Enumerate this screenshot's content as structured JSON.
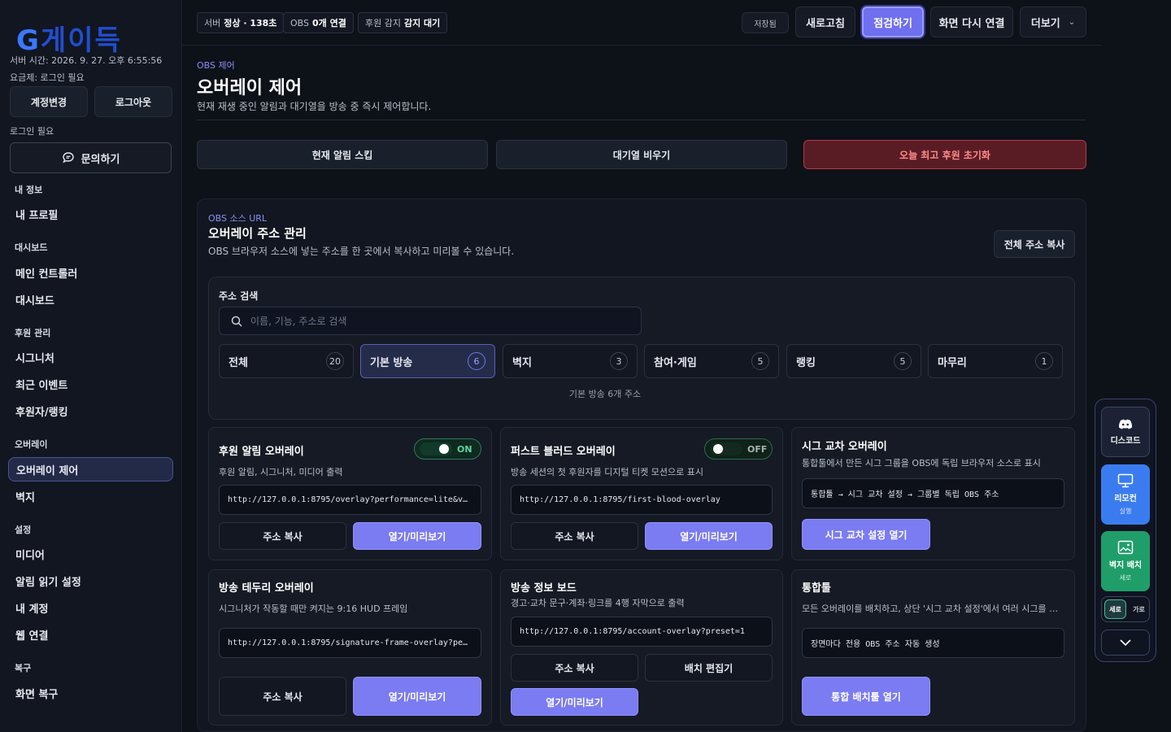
{
  "sidebar": {
    "logo_g": "G",
    "logo_rest": "게이득",
    "server_time": "서버 시간: 2026. 9. 27. 오후 6:55:56",
    "plan": "요금제: 로그인 필요",
    "change_account": "계정변경",
    "logout": "로그아웃",
    "login_required": "로그인 필요",
    "inquiry": "문의하기",
    "sections": [
      {
        "title": "내 정보",
        "items": [
          "내 프로필"
        ]
      },
      {
        "title": "대시보드",
        "items": [
          "메인 컨트롤러",
          "대시보드"
        ]
      },
      {
        "title": "후원 관리",
        "items": [
          "시그니처",
          "최근 이벤트",
          "후원자/랭킹"
        ]
      },
      {
        "title": "오버레이",
        "items": [
          "오버레이 제어",
          "벽지"
        ]
      },
      {
        "title": "설정",
        "items": [
          "미디어",
          "알림 읽기 설정",
          "내 계정",
          "웹 연결"
        ]
      },
      {
        "title": "복구",
        "items": [
          "화면 복구"
        ]
      }
    ]
  },
  "topbar": {
    "status_chips": [
      {
        "label": "서버",
        "value": "정상 · 138초"
      },
      {
        "label": "OBS",
        "value": "0개 연결"
      },
      {
        "label": "후원 감지",
        "value": "감지 대기"
      }
    ],
    "saved": "저장됨",
    "refresh": "새로고침",
    "check": "점검하기",
    "reconnect": "화면 다시 연결",
    "more": "더보기",
    "more_arrow": "⌄"
  },
  "page": {
    "crumb": "OBS 제어",
    "title": "오버레이 제어",
    "subtitle": "현재 재생 중인 알림과 대기열을 방송 중 즉시 제어합니다.",
    "actions": {
      "skip": "현재 알림 스킵",
      "clear_queue": "대기열 비우기",
      "reset_top": "오늘 최고 후원 초기화"
    }
  },
  "panel": {
    "crumb": "OBS 소스 URL",
    "title": "오버레이 주소 관리",
    "desc": "OBS 브라우저 소스에 넣는 주소를 한 곳에서 복사하고 미리볼 수 있습니다.",
    "copy_all": "전체 주소 복사",
    "search_label": "주소 검색",
    "search_placeholder": "이름, 기능, 주소로 검색",
    "filters": [
      {
        "label": "전체",
        "count": "20"
      },
      {
        "label": "기본 방송",
        "count": "6"
      },
      {
        "label": "벽지",
        "count": "3"
      },
      {
        "label": "참여·게임",
        "count": "5"
      },
      {
        "label": "랭킹",
        "count": "5"
      },
      {
        "label": "마무리",
        "count": "1"
      }
    ],
    "filter_note": "기본 방송 6개 주소"
  },
  "cards": {
    "donation_alert": {
      "title": "후원 알림 오버레이",
      "desc": "후원 알림, 시그니처, 미디어 출력",
      "toggle": "ON",
      "url": "http://127.0.0.1:8795/overlay?performance=lite&v…",
      "copy": "주소 복사",
      "open": "열기/미리보기"
    },
    "first_blood": {
      "title": "퍼스트 블러드 오버레이",
      "desc": "방송 세션의 첫 후원자를 디지털 티켓 모션으로 표시",
      "toggle": "OFF",
      "url": "http://127.0.0.1:8795/first-blood-overlay",
      "copy": "주소 복사",
      "open": "열기/미리보기"
    },
    "sig_cross": {
      "title": "시그 교차 오버레이",
      "desc": "통합툴에서 만든 시그 그룹을 OBS에 독립 브라우저 소스로 표시",
      "path": "통합툴 → 시그 교차 설정 → 그룹별 독립 OBS 주소",
      "open": "시그 교차 설정 열기"
    },
    "frame": {
      "title": "방송 테두리 오버레이",
      "desc": "시그니처가 작동할 때만 켜지는 9:16 HUD 프레임",
      "url": "http://127.0.0.1:8795/signature-frame-overlay?pe…",
      "copy": "주소 복사",
      "open": "열기/미리보기"
    },
    "info_board": {
      "title": "방송 정보 보드",
      "desc": "경고·교차 문구·계좌·링크를 4행 자막으로 출력",
      "url": "http://127.0.0.1:8795/account-overlay?preset=1",
      "copy": "주소 복사",
      "edit": "배치 편집기",
      "open": "열기/미리보기"
    },
    "integrated": {
      "title": "통합툴",
      "desc": "모든 오버레이를 배치하고, 상단 '시그 교차 설정'에서 여러 시그를 …",
      "path": "장면마다 전용 OBS 주소 자동 생성",
      "open": "통합 배치툴 열기"
    }
  },
  "float_panel": {
    "discord": "디스코드",
    "remote": "리모컨",
    "remote_sub": "실행",
    "wallpaper": "벽지 배치",
    "wallpaper_sub": "세로",
    "seg_vertical": "세로",
    "seg_horizontal": "가로"
  },
  "colors": {
    "accent": "#7b7bf2",
    "danger": "#b23a46",
    "on_green": "#5fd49c",
    "remote_blue": "#3a7cf0",
    "wallpaper_green": "#1f9e6a"
  }
}
